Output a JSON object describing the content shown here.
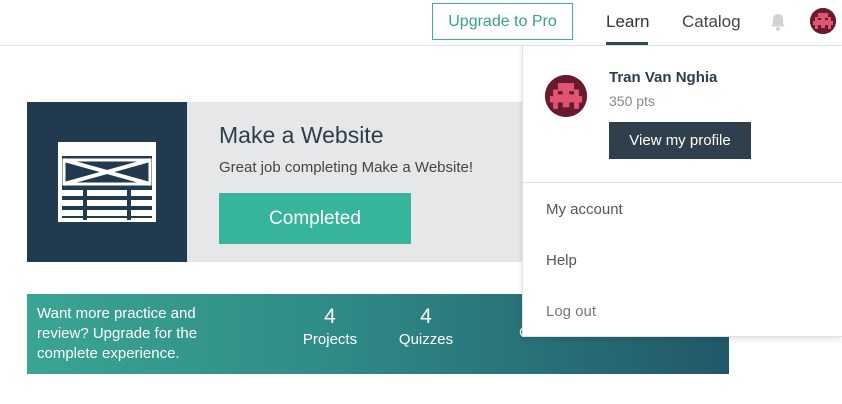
{
  "nav": {
    "upgrade_label": "Upgrade to Pro",
    "learn_label": "Learn",
    "catalog_label": "Catalog",
    "bell_icon": "bell-icon",
    "avatar_icon": "space-invader-avatar"
  },
  "course": {
    "title": "Make a Website",
    "subtitle": "Great job completing Make a Website!",
    "status_label": "Completed",
    "icon": "website-wireframe-icon"
  },
  "banner": {
    "text": "Want more practice and review? Upgrade for the complete experience.",
    "stats": [
      {
        "value": "4",
        "label": "Projects"
      },
      {
        "value": "4",
        "label": "Quizzes"
      }
    ],
    "cta_label": "Get Instant Access »"
  },
  "user_menu": {
    "name": "Tran Van Nghia",
    "points": "350 pts",
    "view_profile_label": "View my profile",
    "items": [
      "My account",
      "Help",
      "Log out"
    ]
  },
  "colors": {
    "accent": "#37b49c",
    "navy": "#223a4f",
    "dark_button": "#2f3f4b",
    "avatar": "#6a1a2e"
  }
}
